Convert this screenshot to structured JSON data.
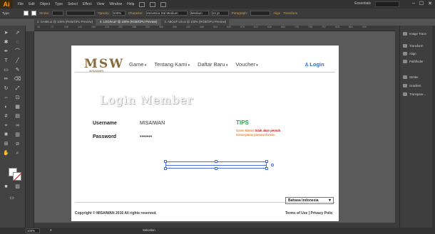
{
  "app": {
    "logo": "Ai",
    "menus": [
      "File",
      "Edit",
      "Object",
      "Type",
      "Select",
      "Effect",
      "View",
      "Window",
      "Help"
    ],
    "workspace": "Essentials",
    "window_controls": [
      "–",
      "☐",
      "✕"
    ]
  },
  "control_bar": {
    "selection_type": "Type",
    "stroke_label": "Stroke:",
    "opacity_label": "Opacity:",
    "opacity_value": "100%",
    "character_label": "Character:",
    "font_name": "Helvetica Std Medium",
    "font_style": "Medium",
    "font_size": "12 pt",
    "paragraph_label": "Paragraph:",
    "align_label": "Align",
    "transform_label": "Transform"
  },
  "tabs": [
    {
      "label": "2. GAME.ai @ 100% (RGB/GPU Preview)",
      "active": false
    },
    {
      "label": "4. LOGIN.ai* @ 100% (RGB/GPU Preview)",
      "active": true
    },
    {
      "label": "3. ABOUT US.ai @ 100% (RGB/GPU Preview)",
      "active": false
    }
  ],
  "ruler_ticks": [
    "36",
    "72",
    "108",
    "144",
    "180",
    "216",
    "252",
    "288",
    "324",
    "360",
    "396",
    "432",
    "468",
    "504",
    "540",
    "576",
    "612",
    "648",
    "684",
    "720",
    "756",
    "792",
    "828",
    "864",
    "900"
  ],
  "site": {
    "logo_text": "MSW",
    "logo_sub": "MISAIWAN",
    "nav": [
      "Game",
      "Tentang Kami",
      "Daftar Baru",
      "Voucher"
    ],
    "login_link": "Login",
    "page_title": "Login Member",
    "username_label": "Username",
    "username_value": "MISAIWAN",
    "password_label": "Password",
    "password_value": "•••••••",
    "tips_title": "TIPS",
    "tips_line1_prefix": "Game Master",
    "tips_line1_highlight": "tidak akan pernah",
    "tips_line2": "menanyakan password kamu",
    "copyright": "Copyright © MISAIWAN 2016 All rights reserved.",
    "language": "Bahasa Indonesia",
    "footer_links": "Terms of Use | Privacy Polic"
  },
  "panels": [
    {
      "label": "Image Trace",
      "icon": "image-trace-icon"
    },
    {
      "label": "Transform",
      "icon": "transform-icon"
    },
    {
      "label": "Align",
      "icon": "align-icon"
    },
    {
      "label": "Pathfinder",
      "icon": "pathfinder-icon"
    },
    {
      "label": "Stroke",
      "icon": "stroke-icon"
    },
    {
      "label": "Gradient",
      "icon": "gradient-icon"
    },
    {
      "label": "Transpare...",
      "icon": "transparency-icon"
    }
  ],
  "status": {
    "zoom": "100%",
    "artboard": "4",
    "tool": "Selection"
  },
  "colors": {
    "accent": "#ff9a00",
    "tips_green": "#21a83a",
    "tips_orange": "#d15a00",
    "login_blue": "#2a6fc0",
    "logo_brown": "#8a6a3c",
    "selection_blue": "#4a6fd8"
  }
}
